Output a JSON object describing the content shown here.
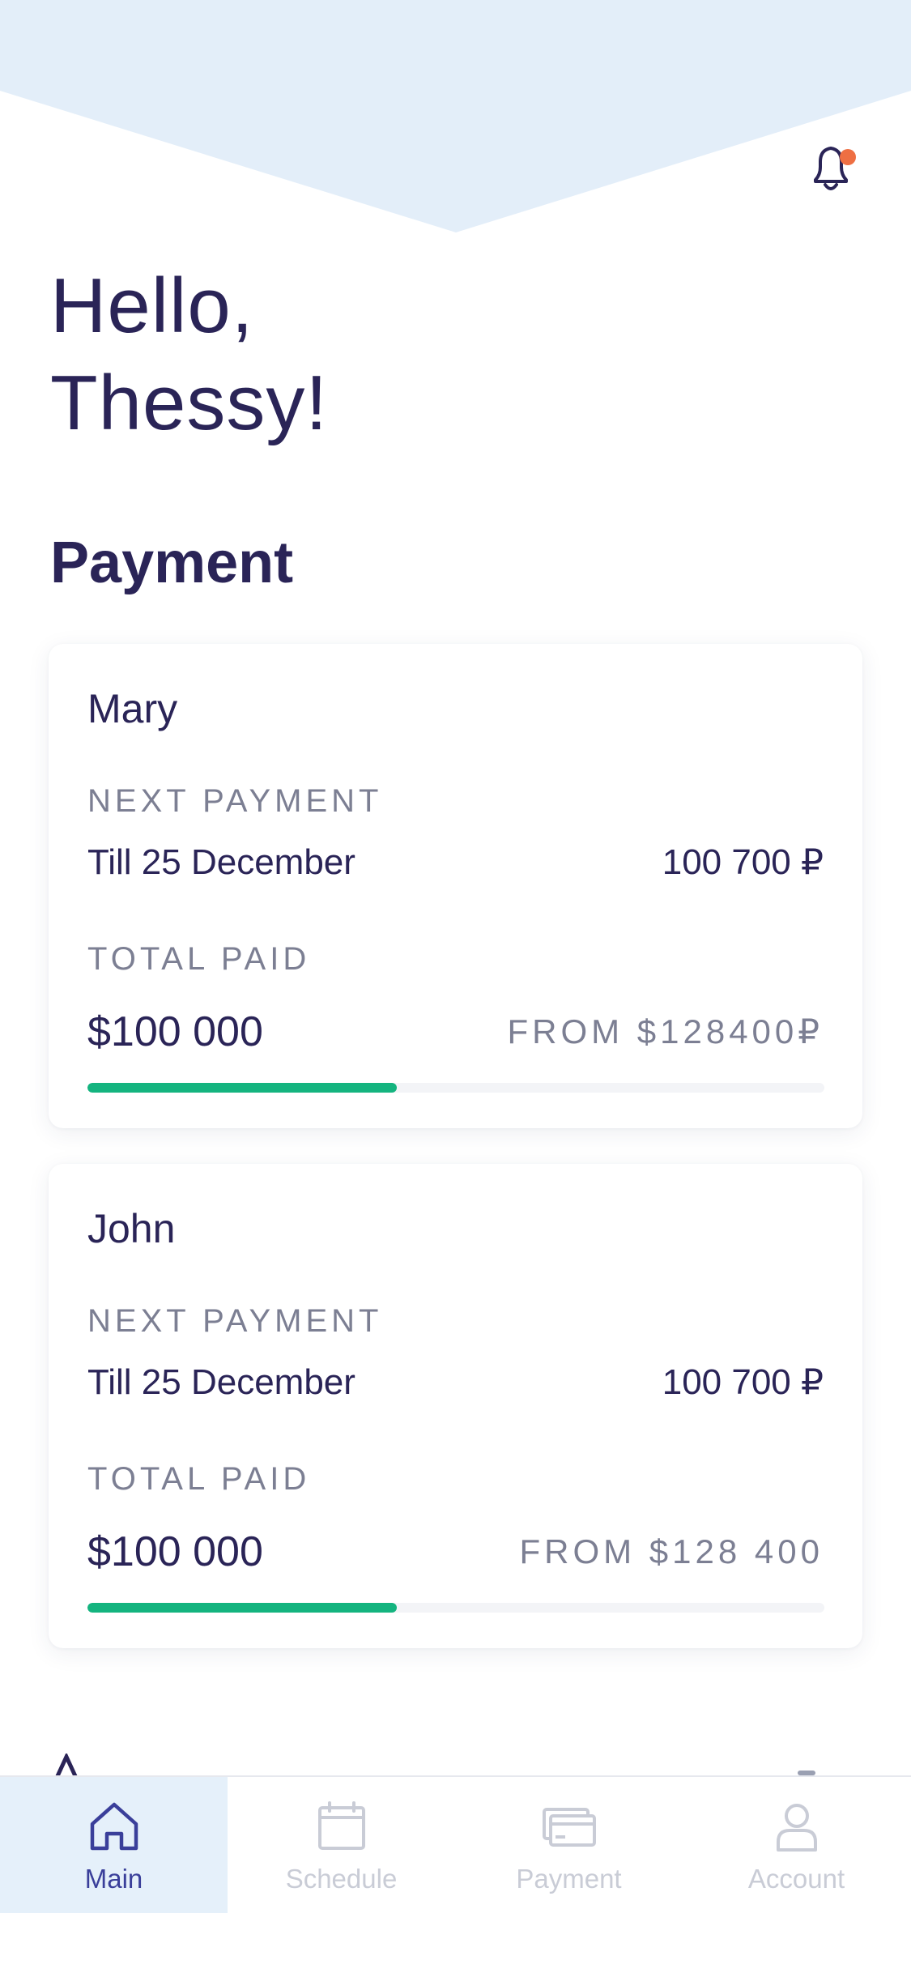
{
  "colors": {
    "header_band": "#e3eef9",
    "text_primary": "#2a2457",
    "text_secondary": "#7c7f93",
    "progress_fill": "#14b47f",
    "progress_track": "#f3f4f7",
    "notification_dot": "#ee6f43",
    "tab_active_bg": "#e5f0fa",
    "tab_active": "#3a3f9a",
    "tab_inactive": "#c9ccd6"
  },
  "header": {
    "greeting": "Hello,\nThessy!",
    "notification_icon": "bell-icon",
    "has_unread": true
  },
  "section": {
    "title": "Payment"
  },
  "payments": [
    {
      "name": "Mary",
      "next_label": "NEXT PAYMENT",
      "due_date": "Till 25 December",
      "due_amount": "100 700 ₽",
      "total_label": "TOTAL PAID",
      "paid": "$100 000",
      "from": "FROM $128400₽",
      "progress": 0.42
    },
    {
      "name": "John",
      "next_label": "NEXT PAYMENT",
      "due_date": "Till 25 December",
      "due_amount": "100 700 ₽",
      "total_label": "TOTAL PAID",
      "paid": "$100 000",
      "from": "FROM $128 400",
      "progress": 0.42
    }
  ],
  "tabbar": {
    "tabs": [
      {
        "label": "Main",
        "icon": "home-icon",
        "active": true
      },
      {
        "label": "Schedule",
        "icon": "calendar-icon",
        "active": false
      },
      {
        "label": "Payment",
        "icon": "card-icon",
        "active": false
      },
      {
        "label": "Account",
        "icon": "user-icon",
        "active": false
      }
    ]
  }
}
